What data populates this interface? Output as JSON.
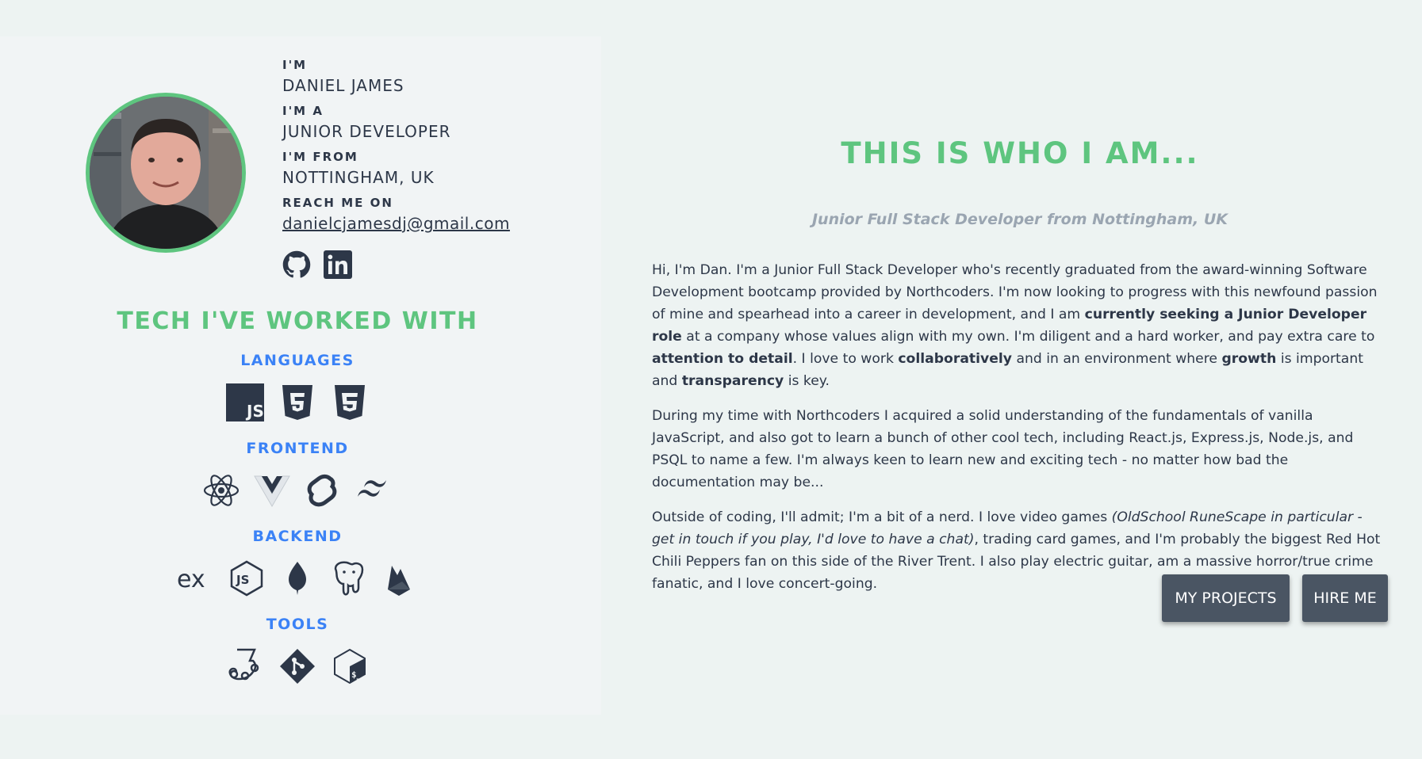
{
  "profile": {
    "name_label": "I'M",
    "name": "DANIEL JAMES",
    "role_label": "I'M A",
    "role": "JUNIOR DEVELOPER",
    "from_label": "I'M FROM",
    "from": "NOTTINGHAM, UK",
    "contact_label": "REACH ME ON",
    "email": "danielcjamesdj@gmail.com",
    "socials": [
      "github-icon",
      "linkedin-icon"
    ]
  },
  "tech": {
    "title": "TECH I'VE WORKED WITH",
    "categories": [
      {
        "label": "LANGUAGES",
        "icons": [
          "javascript-icon",
          "html5-icon",
          "css3-icon"
        ]
      },
      {
        "label": "FRONTEND",
        "icons": [
          "react-icon",
          "vue-icon",
          "svelte-icon",
          "tailwind-icon"
        ]
      },
      {
        "label": "BACKEND",
        "icons": [
          "express-icon",
          "nodejs-icon",
          "mongodb-icon",
          "postgresql-icon",
          "firebase-icon"
        ]
      },
      {
        "label": "TOOLS",
        "icons": [
          "jest-icon",
          "git-icon",
          "bash-icon"
        ]
      }
    ]
  },
  "about": {
    "heading": "THIS IS WHO I AM...",
    "subtitle": "Junior Full Stack Developer from Nottingham, UK",
    "p1": [
      "Hi, I'm Dan. I'm a Junior Full Stack Developer who's recently graduated from the award-winning Software Development bootcamp provided by Northcoders. I'm now looking to progress with this newfound passion of mine and spearhead into a career in development, and I am ",
      "currently seeking a Junior Developer role",
      " at a company whose values align with my own. I'm diligent and a hard worker, and pay extra care to ",
      "attention to detail",
      ". I love to work ",
      "collaboratively",
      " and in an environment where ",
      "growth",
      " is important and ",
      "transparency",
      " is key."
    ],
    "p2": "During my time with Northcoders I acquired a solid understanding of the fundamentals of vanilla JavaScript, and also got to learn a bunch of other cool tech, including React.js, Express.js, Node.js, and PSQL to name a few. I'm always keen to learn new and exciting tech - no matter how bad the documentation may be...",
    "p3": [
      "Outside of coding, I'll admit; I'm a bit of a nerd. I love video games ",
      "(OldSchool RuneScape in particular - get in touch if you play, I'd love to have a chat)",
      ", trading card games, and I'm probably the biggest Red Hot Chili Peppers fan on this side of the River Trent. I also play electric guitar, am a massive horror/true crime fanatic, and I love concert-going."
    ]
  },
  "buttons": {
    "projects": "MY PROJECTS",
    "hire": "HIRE ME"
  },
  "colors": {
    "accent_green": "#5ec57f",
    "category_blue": "#3b82f6",
    "button_bg": "#4a5563",
    "text_dark": "#2d3748"
  }
}
